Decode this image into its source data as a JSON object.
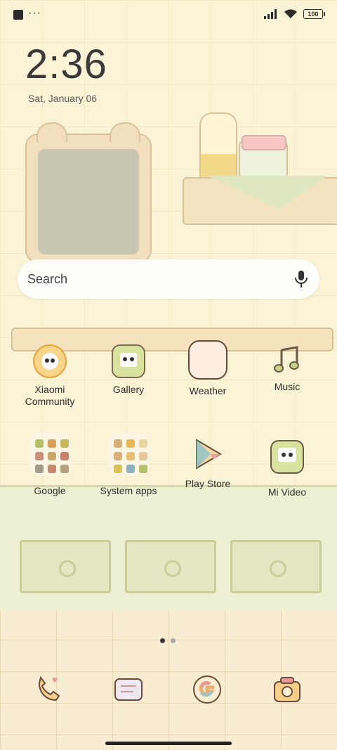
{
  "status": {
    "dots": "···",
    "battery": "100"
  },
  "clock": {
    "time": "2:36",
    "date": "Sat, January 06"
  },
  "search": {
    "placeholder": "Search"
  },
  "apps_row1": [
    {
      "label": "Xiaomi\nCommunity",
      "icon": "xiaomi-community-icon"
    },
    {
      "label": "Gallery",
      "icon": "gallery-icon"
    },
    {
      "label": "Weather",
      "icon": "weather-icon"
    },
    {
      "label": "Music",
      "icon": "music-icon"
    }
  ],
  "apps_row2": [
    {
      "label": "Google",
      "icon": "google-folder-icon"
    },
    {
      "label": "System apps",
      "icon": "system-apps-folder-icon"
    },
    {
      "label": "Play Store",
      "icon": "play-store-icon"
    },
    {
      "label": "Mi Video",
      "icon": "mi-video-icon"
    }
  ],
  "dock": [
    {
      "icon": "phone-icon"
    },
    {
      "icon": "messages-icon"
    },
    {
      "icon": "chrome-google-icon"
    },
    {
      "icon": "camera-icon"
    }
  ],
  "page_indicator": {
    "pages": 2,
    "current": 1
  },
  "colors": {
    "text": "#2f2f2f",
    "accent_green": "#c9d38a",
    "wall": "#fbf3d6"
  }
}
